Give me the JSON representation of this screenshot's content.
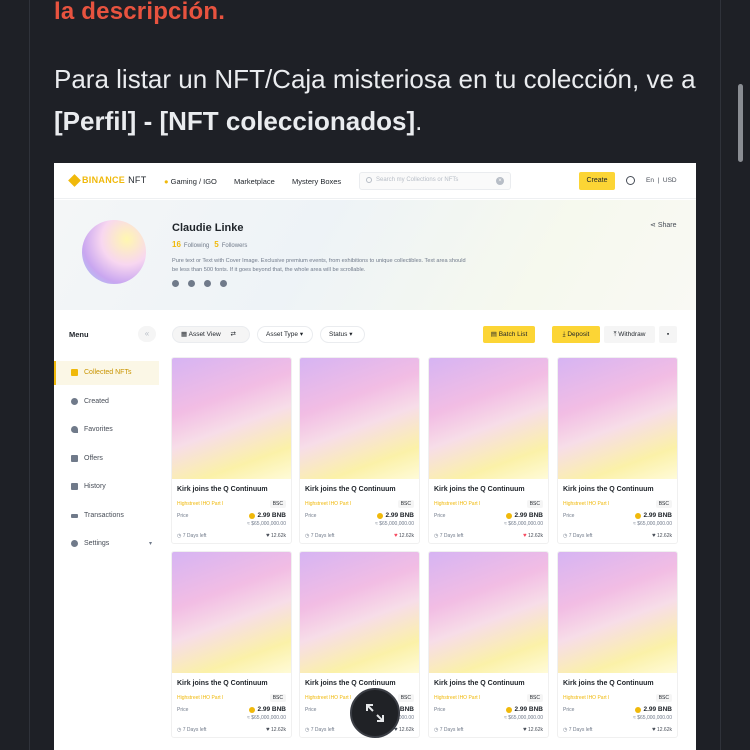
{
  "article": {
    "heading_tail": "la descripción.",
    "para_part1": "Para listar un NFT/Caja misteriosa en tu colección, ve a ",
    "para_bold": "[Perfil] - [NFT coleccionados]",
    "para_end": "."
  },
  "app": {
    "logo_brand": "BINANCE",
    "logo_product": "NFT",
    "nav": [
      "Gaming / IGO",
      "Marketplace",
      "Mystery Boxes"
    ],
    "search_placeholder": "Search my Collections or NFTs",
    "create_label": "Create",
    "lang": "En",
    "currency": "USD",
    "profile": {
      "name": "Claudie Linke",
      "following_count": "16",
      "following_label": "Following",
      "followers_count": "5",
      "followers_label": "Followers",
      "bio": "Pure text or Text with Cover Image. Exclusive premium events, from exhibitions to unique collectibles. Text area should be less than 500 fonts. If it goes beyond that, the whole area will be scrollable.",
      "share_label": "Share"
    },
    "menu": {
      "title": "Menu",
      "items": [
        "Collected NFTs",
        "Created",
        "Favorites",
        "Offers",
        "History",
        "Transactions",
        "Settings"
      ]
    },
    "toolbar": {
      "asset_view": "Asset View",
      "asset_type": "Asset Type",
      "status": "Status",
      "batch_list": "Batch List",
      "deposit": "Deposit",
      "withdraw": "Withdraw"
    },
    "card": {
      "title": "Kirk joins the Q Continuum",
      "subtitle": "Highstreet IHO Part I",
      "chain": "BSC",
      "price_label": "Price",
      "price": "2.99 BNB",
      "usd": "≈ $65,000,000.00",
      "days": "7 Days left",
      "likes": "12.62k"
    }
  },
  "colors": {
    "accent": "#f0b90b",
    "heading_red": "#e8533f",
    "bg_dark": "#1e2026"
  }
}
